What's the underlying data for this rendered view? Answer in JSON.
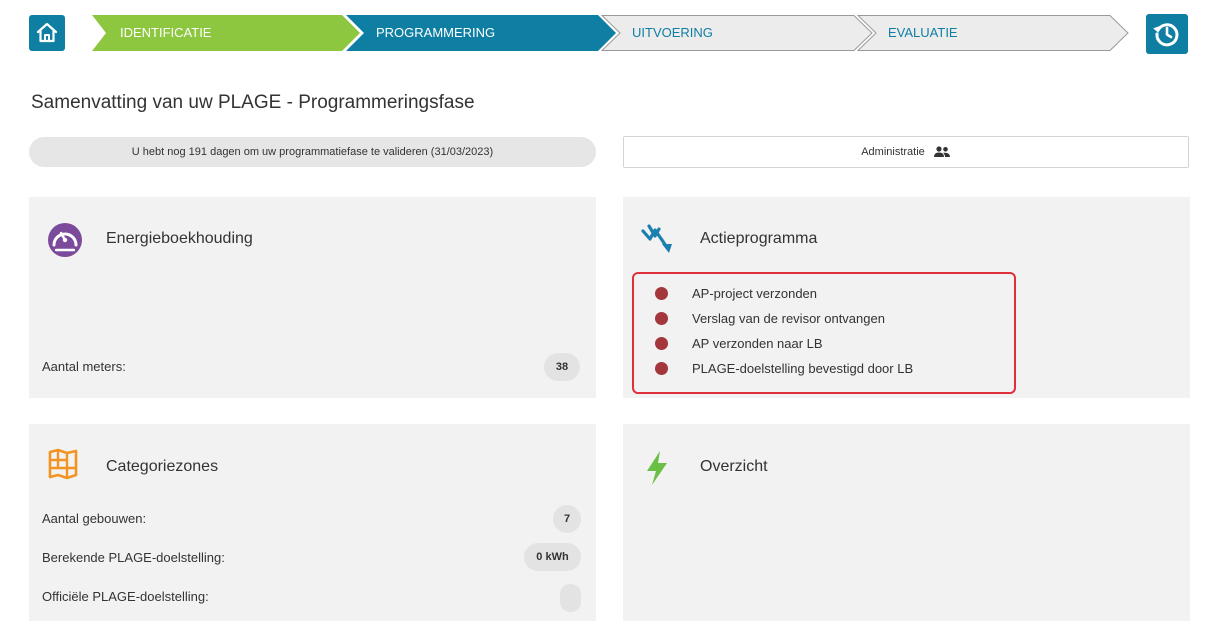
{
  "stepper": {
    "steps": [
      {
        "label": "IDENTIFICATIE"
      },
      {
        "label": "PROGRAMMERING"
      },
      {
        "label": "UITVOERING"
      },
      {
        "label": "EVALUATIE"
      }
    ],
    "home_icon": "home-icon",
    "history_icon": "history-icon"
  },
  "page": {
    "title": "Samenvatting van uw PLAGE - Programmeringsfase",
    "deadline_text": "U hebt nog 191 dagen om uw programmatiefase te valideren (31/03/2023)",
    "admin_label": "Administratie",
    "admin_icon": "users-icon"
  },
  "energy": {
    "title": "Energieboekhouding",
    "icon": "gauge-icon",
    "meters_label": "Aantal meters:",
    "meters_value": "38"
  },
  "action_program": {
    "title": "Actieprogramma",
    "icon": "trend-down-icon",
    "items": [
      {
        "label": "AP-project verzonden"
      },
      {
        "label": "Verslag van de revisor ontvangen"
      },
      {
        "label": "AP verzonden naar LB"
      },
      {
        "label": "PLAGE-doelstelling bevestigd door LB"
      }
    ]
  },
  "category": {
    "title": "Categoriezones",
    "icon": "map-icon",
    "rows": [
      {
        "label": "Aantal gebouwen:",
        "value": "7"
      },
      {
        "label": "Berekende PLAGE-doelstelling:",
        "value": "0 kWh"
      },
      {
        "label": "Officiële PLAGE-doelstelling:",
        "value": ""
      }
    ]
  },
  "overview": {
    "title": "Overzicht",
    "icon": "lightning-icon"
  },
  "colors": {
    "accent_green": "#8dc63f",
    "accent_blue": "#0e7fa3",
    "status_red": "#a3373c",
    "highlight_red": "#e0303c"
  }
}
